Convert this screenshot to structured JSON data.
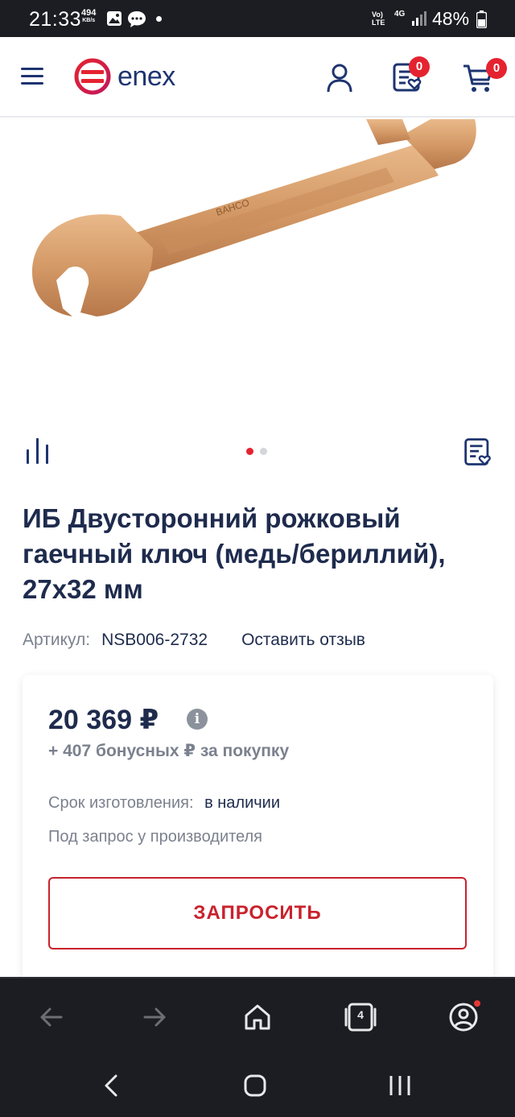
{
  "status_bar": {
    "time": "21:33",
    "speed_value": "494",
    "speed_unit": "KB/s",
    "network_volte": "Vo) LTE",
    "network_4g": "4G",
    "battery": "48%"
  },
  "header": {
    "logo_text": "enex",
    "favorites_count": "0",
    "cart_count": "0",
    "icons": [
      "menu-icon",
      "user-icon",
      "favorites-list-icon",
      "cart-icon"
    ]
  },
  "gallery": {
    "slides_total": 2,
    "active_slide": 1,
    "image_desc_icons": [
      "compare-icon",
      "favorites-list-icon"
    ]
  },
  "product": {
    "title": "ИБ Двусторонний рожковый гаечный ключ (медь/бериллий), 27x32 мм",
    "sku_label": "Артикул:",
    "sku_value": "NSB006-2732",
    "review_link": "Оставить отзыв"
  },
  "price_card": {
    "price": "20 369 ₽",
    "info_icon": "i",
    "bonus": "+ 407 бонусных ₽ за покупку",
    "term_label": "Срок изготовления:",
    "term_value": "в наличии",
    "on_request": "Под запрос у производителя",
    "request_button": "ЗАПРОСИТЬ"
  },
  "browser_bar": {
    "tabs_count": "4",
    "icons": [
      "back-arrow-icon",
      "forward-arrow-icon",
      "home-icon",
      "tabs-icon",
      "profile-icon"
    ]
  },
  "colors": {
    "brand_blue": "#1e3470",
    "accent_red": "#e52330",
    "button_red": "#c9222d",
    "muted_text": "#7b818e",
    "system_bar": "#1b1d22"
  }
}
